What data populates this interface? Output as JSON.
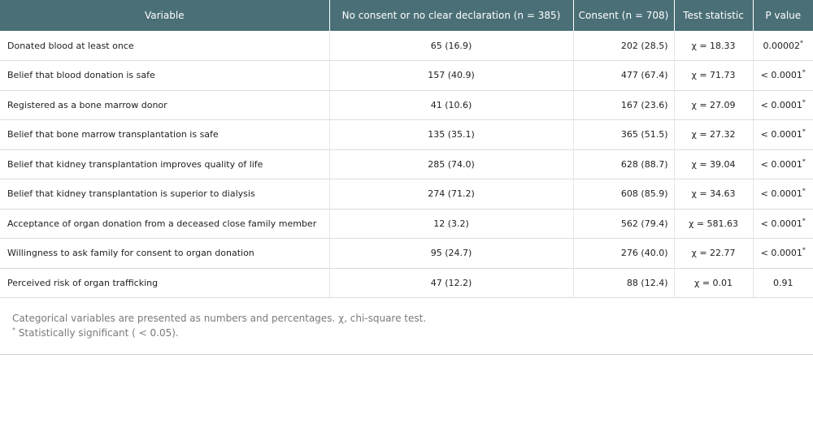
{
  "table": {
    "headers": {
      "variable": "Variable",
      "no_consent": "No consent or no clear declaration (n = 385)",
      "consent": "Consent (n = 708)",
      "test_statistic": "Test statistic",
      "p_value": "P value"
    },
    "rows": [
      {
        "variable": "Donated blood at least once",
        "no_consent": "65 (16.9)",
        "consent": "202 (28.5)",
        "stat": "χ = 18.33",
        "p": "0.00002",
        "sig": "*"
      },
      {
        "variable": "Belief that blood donation is safe",
        "no_consent": "157 (40.9)",
        "consent": "477 (67.4)",
        "stat": "χ = 71.73",
        "p": "< 0.0001",
        "sig": "*"
      },
      {
        "variable": "Registered as a bone marrow donor",
        "no_consent": "41 (10.6)",
        "consent": "167 (23.6)",
        "stat": "χ = 27.09",
        "p": "< 0.0001",
        "sig": "*"
      },
      {
        "variable": "Belief that bone marrow transplantation is safe",
        "no_consent": "135 (35.1)",
        "consent": "365 (51.5)",
        "stat": "χ = 27.32",
        "p": "< 0.0001",
        "sig": "*"
      },
      {
        "variable": "Belief that kidney transplantation improves quality of life",
        "no_consent": "285 (74.0)",
        "consent": "628 (88.7)",
        "stat": "χ = 39.04",
        "p": "< 0.0001",
        "sig": "*"
      },
      {
        "variable": "Belief that kidney transplantation is superior to dialysis",
        "no_consent": "274 (71.2)",
        "consent": "608 (85.9)",
        "stat": "χ = 34.63",
        "p": "< 0.0001",
        "sig": "*"
      },
      {
        "variable": "Acceptance of organ donation from a deceased close family member",
        "no_consent": "12 (3.2)",
        "consent": "562 (79.4)",
        "stat": "χ = 581.63",
        "p": "< 0.0001",
        "sig": "*"
      },
      {
        "variable": "Willingness to ask family for consent to organ donation",
        "no_consent": "95 (24.7)",
        "consent": "276 (40.0)",
        "stat": "χ = 22.77",
        "p": "< 0.0001",
        "sig": "*"
      },
      {
        "variable": "Perceived risk of organ trafficking",
        "no_consent": "47 (12.2)",
        "consent": "88 (12.4)",
        "stat": "χ = 0.01",
        "p": "0.91",
        "sig": ""
      }
    ]
  },
  "footnotes": {
    "line1": "Categorical variables are presented as numbers and percentages. χ, chi-square test.",
    "line2_marker": "*",
    "line2": " Statistically significant ( < 0.05)."
  }
}
